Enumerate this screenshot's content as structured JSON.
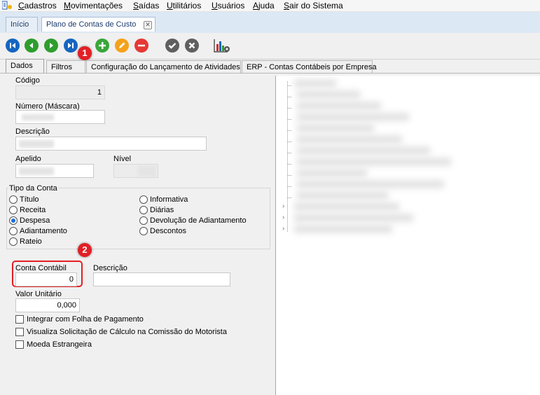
{
  "menu": {
    "items": [
      "Cadastros",
      "Movimentações",
      "Saídas",
      "Utilitários",
      "Usuários",
      "Ajuda",
      "Sair do Sistema"
    ]
  },
  "window_tabs": {
    "home": "Início",
    "active": "Plano de Contas de Custo"
  },
  "badges": {
    "one": "1",
    "two": "2"
  },
  "inner_tabs": [
    "Dados",
    "Filtros",
    "Configuração do Lançamento de Atividades",
    "ERP - Contas Contábeis por Empresa"
  ],
  "form": {
    "codigo_label": "Código",
    "codigo_value": "1",
    "numero_label": "Número (Máscara)",
    "descricao_label": "Descrição",
    "apelido_label": "Apelido",
    "nivel_label": "Nível",
    "tipo_legend": "Tipo da Conta",
    "tipo_left": [
      "Título",
      "Receita",
      "Despesa",
      "Adiantamento",
      "Rateio"
    ],
    "tipo_right": [
      "Informativa",
      "Diárias",
      "Devolução de Adiantamento",
      "Descontos"
    ],
    "tipo_selected": "Despesa",
    "conta_contabil_label": "Conta Contábil",
    "conta_contabil_value": "0",
    "descricao2_label": "Descrição",
    "valor_label": "Valor Unitário",
    "valor_value": "0,000",
    "checks": [
      "Integrar com Folha de Pagamento",
      "Visualiza Solicitação de Cálculo na Comissão do Motorista",
      "Moeda Estrangeira"
    ]
  },
  "colors": {
    "accent_blue": "#1c6fd8",
    "nav_blue": "#1565c0",
    "nav_green": "#2e9d2e",
    "add_green": "#3aa63a",
    "edit_orange": "#f4a21b",
    "delete_red": "#e53935",
    "confirm_gray": "#5f5f5f",
    "badge_red": "#e21f26"
  },
  "icons": {
    "toolbar": [
      "first-record-icon",
      "previous-record-icon",
      "next-record-icon",
      "last-record-icon",
      "add-icon",
      "edit-icon",
      "delete-icon",
      "confirm-icon",
      "cancel-icon",
      "report-chart-icon"
    ]
  }
}
